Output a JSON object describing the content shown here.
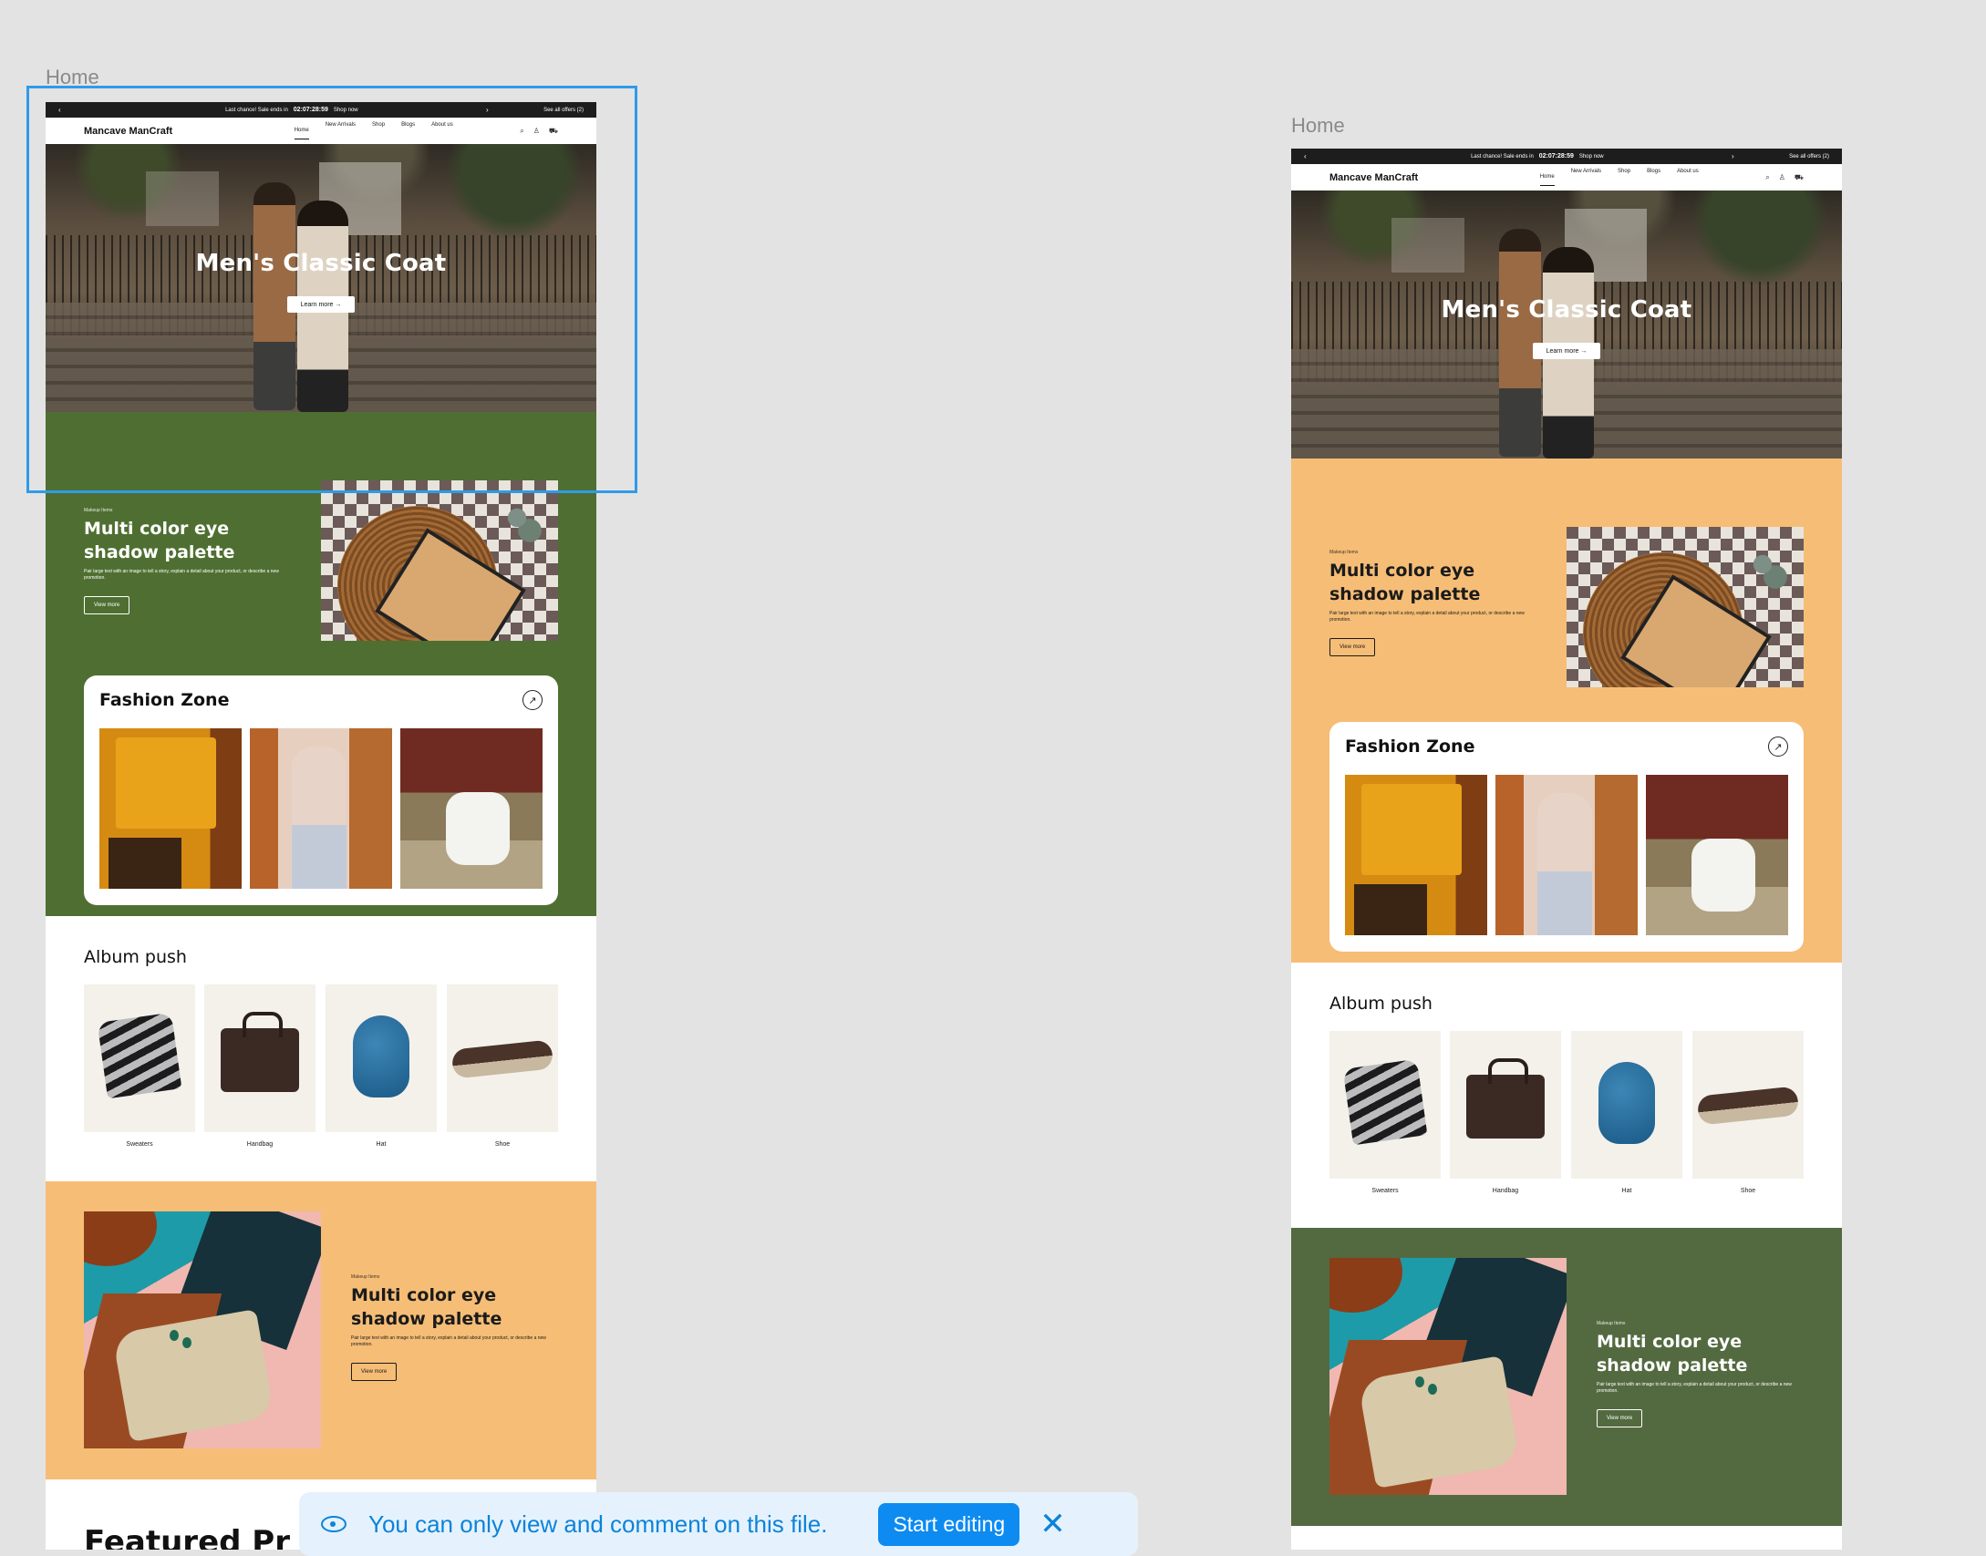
{
  "canvas": {
    "frames": [
      {
        "label": "Home"
      },
      {
        "label": "Home"
      }
    ]
  },
  "site": {
    "promo_bar": {
      "prev_arrow": "‹",
      "message": "Last chance! Sale ends in",
      "countdown": "02:07:28:59",
      "shop_now": "Shop now",
      "next_arrow": "›",
      "offers": "See all offers (2)"
    },
    "brand": "Mancave ManCraft",
    "nav": [
      "Home",
      "New Arrivals",
      "Shop",
      "Blogs",
      "About us"
    ],
    "nav_active": "Home",
    "icons": [
      "search-icon",
      "user-icon",
      "cart-icon"
    ],
    "hero": {
      "title": "Men's Classic Coat",
      "button": "Learn more →"
    },
    "promo_section": {
      "kicker": "Makeup Items",
      "title_line1": "Multi color eye",
      "title_line2": "shadow palette",
      "body": "Pair large text with an image to tell a story, explain a detail about your product, or describe a new promotion.",
      "button": "View more"
    },
    "fashion_zone": {
      "title": "Fashion Zone",
      "arrow": "↗"
    },
    "album": {
      "title": "Album push",
      "items": [
        "Sweaters",
        "Handbag",
        "Hat",
        "Shoe"
      ]
    },
    "featured_title": "Featured Pr"
  },
  "colors": {
    "frame1_promo_bg": "#4e6f31",
    "frame1_zone_bg": "#4e6f31",
    "frame1_bottom_bg": "#f6bd76",
    "frame2_promo_bg": "#f6bd76",
    "frame2_zone_bg": "#f6bd76",
    "frame2_bottom_bg": "#536a40",
    "selection": "#2f9be9"
  },
  "toast": {
    "message": "You can only view and comment on this file.",
    "button": "Start editing",
    "close": "✕"
  }
}
